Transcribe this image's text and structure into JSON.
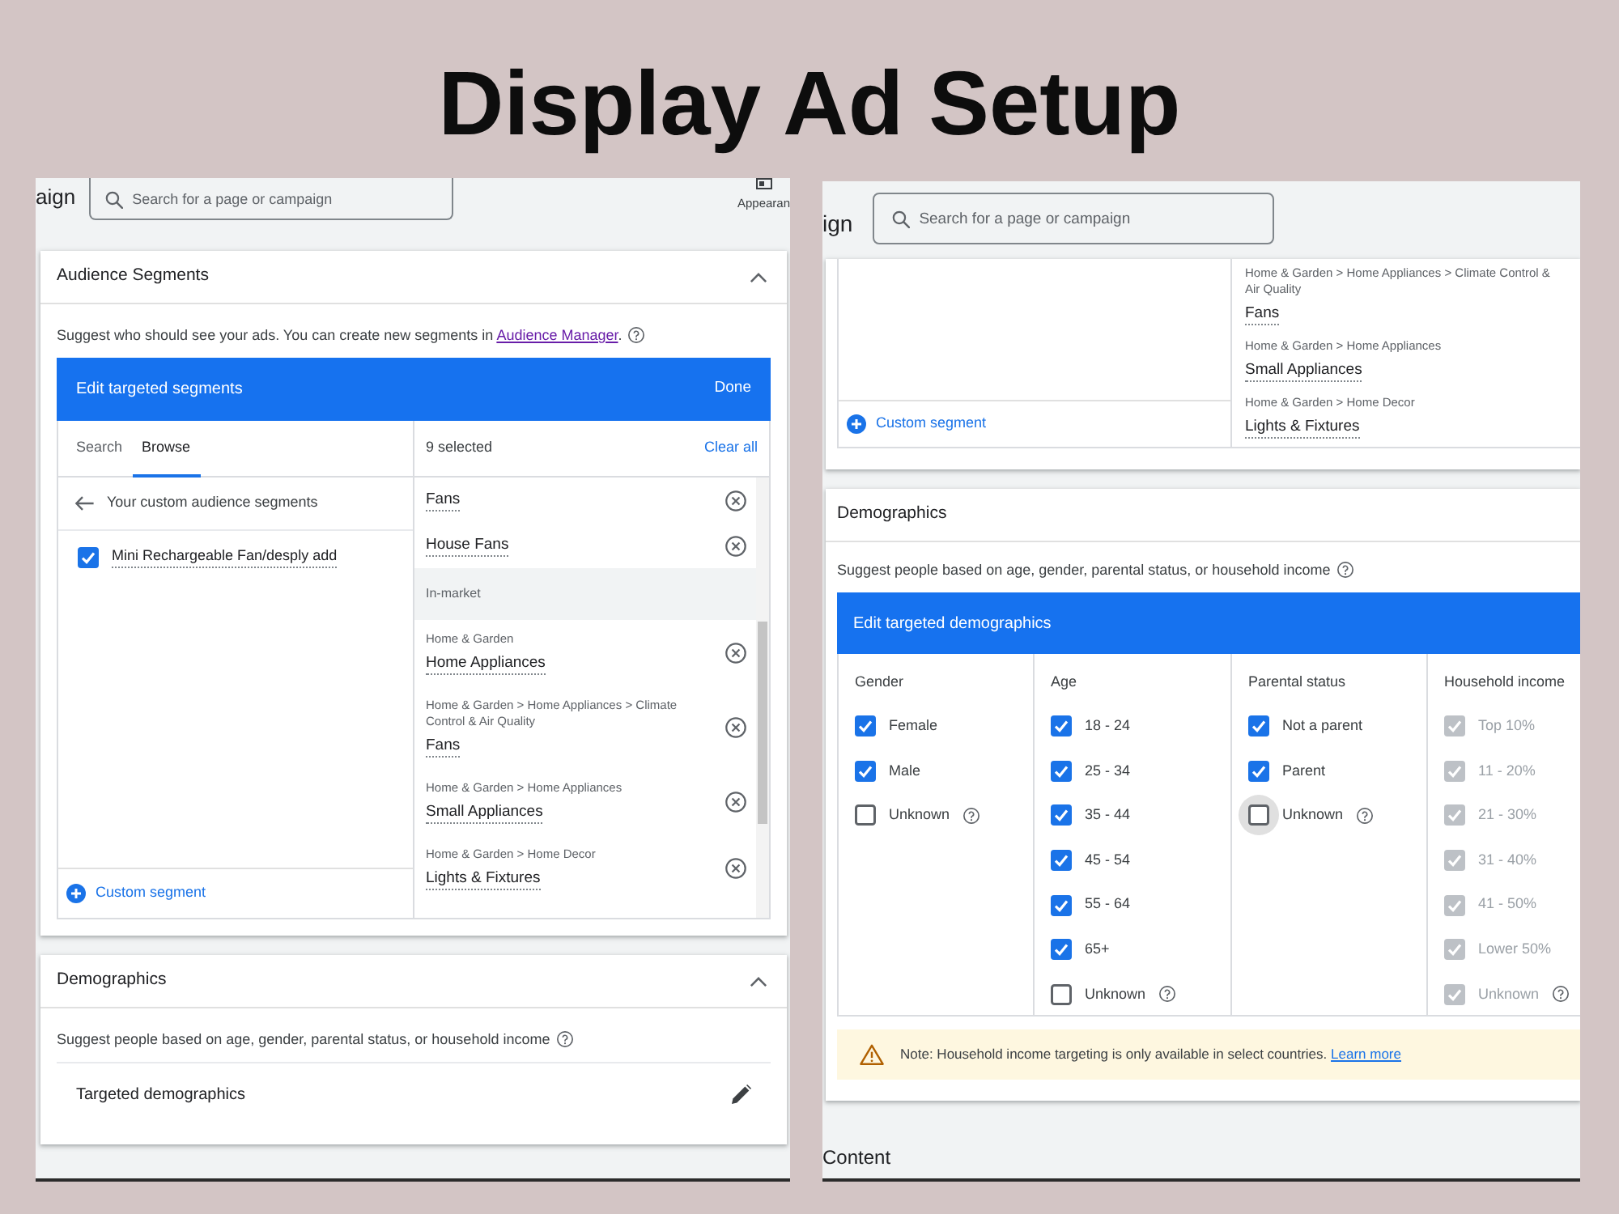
{
  "heading": "Display Ad Setup",
  "left_screenshot": {
    "top_bar": {
      "page_title": "aign",
      "search": {
        "placeholder": "Search for a page or campaign"
      },
      "appearance_label": "Appearan"
    },
    "audience_segments": {
      "title": "Audience Segments",
      "expanded": true,
      "description": "Suggest who should see your ads. You can create new segments in",
      "description_link": "Audience Manager",
      "description_end": ".",
      "editor": {
        "title": "Edit targeted segments",
        "done": "Done",
        "tabs": [
          {
            "label": "Search",
            "selected": false
          },
          {
            "label": "Browse",
            "selected": true
          }
        ],
        "back_label": "Your custom audience segments",
        "segments": [
          {
            "label": "Mini Rechargeable Fan/desply add",
            "checked": true
          }
        ],
        "custom_segment": "Custom segment",
        "selected_count": "9 selected",
        "clear_all": "Clear all",
        "selected_items": [
          {
            "kind": "item",
            "title": "Fans"
          },
          {
            "kind": "item",
            "title": "House Fans"
          },
          {
            "kind": "group",
            "title": "In-market"
          },
          {
            "kind": "item",
            "path": "Home & Garden",
            "title": "Home Appliances"
          },
          {
            "kind": "item",
            "path": "Home & Garden > Home Appliances > Climate Control & Air Quality",
            "title": "Fans"
          },
          {
            "kind": "item",
            "path": "Home & Garden > Home Appliances",
            "title": "Small Appliances"
          },
          {
            "kind": "item",
            "path": "Home & Garden > Home Decor",
            "title": "Lights & Fixtures"
          }
        ]
      }
    },
    "demographics": {
      "title": "Demographics",
      "expanded": true,
      "description": "Suggest people based on age, gender, parental status, or household income",
      "row_label": "Targeted demographics"
    }
  },
  "right_screenshot": {
    "top_bar": {
      "page_title": "ign",
      "search": {
        "placeholder": "Search for a page or campaign"
      }
    },
    "audience_segments": {
      "custom_segment": "Custom segment",
      "selected_items": [
        {
          "kind": "item",
          "path": "Home & Garden > Home Appliances > Climate Control & Air Quality",
          "title": "Fans"
        },
        {
          "kind": "item",
          "path": "Home & Garden > Home Appliances",
          "title": "Small Appliances"
        },
        {
          "kind": "item",
          "path": "Home & Garden > Home Decor",
          "title": "Lights & Fixtures"
        }
      ]
    },
    "demographics": {
      "title": "Demographics",
      "description": "Suggest people based on age, gender, parental status, or household income",
      "editor_title": "Edit targeted demographics",
      "columns": [
        {
          "heading": "Gender",
          "options": [
            {
              "label": "Female",
              "checked": true,
              "disabled": false,
              "has_help": false,
              "focused": false
            },
            {
              "label": "Male",
              "checked": true,
              "disabled": false,
              "has_help": false,
              "focused": false
            },
            {
              "label": "Unknown",
              "checked": false,
              "disabled": false,
              "has_help": true,
              "focused": false
            }
          ]
        },
        {
          "heading": "Age",
          "options": [
            {
              "label": "18 - 24",
              "checked": true,
              "disabled": false,
              "has_help": false,
              "focused": false
            },
            {
              "label": "25 - 34",
              "checked": true,
              "disabled": false,
              "has_help": false,
              "focused": false
            },
            {
              "label": "35 - 44",
              "checked": true,
              "disabled": false,
              "has_help": false,
              "focused": false
            },
            {
              "label": "45 - 54",
              "checked": true,
              "disabled": false,
              "has_help": false,
              "focused": false
            },
            {
              "label": "55 - 64",
              "checked": true,
              "disabled": false,
              "has_help": false,
              "focused": false
            },
            {
              "label": "65+",
              "checked": true,
              "disabled": false,
              "has_help": false,
              "focused": false
            },
            {
              "label": "Unknown",
              "checked": false,
              "disabled": false,
              "has_help": true,
              "focused": false
            }
          ]
        },
        {
          "heading": "Parental status",
          "options": [
            {
              "label": "Not a parent",
              "checked": true,
              "disabled": false,
              "has_help": false,
              "focused": false
            },
            {
              "label": "Parent",
              "checked": true,
              "disabled": false,
              "has_help": false,
              "focused": false
            },
            {
              "label": "Unknown",
              "checked": false,
              "disabled": false,
              "has_help": true,
              "focused": true
            }
          ]
        },
        {
          "heading": "Household income",
          "options": [
            {
              "label": "Top 10%",
              "checked": true,
              "disabled": true,
              "has_help": false,
              "focused": false
            },
            {
              "label": "11 - 20%",
              "checked": true,
              "disabled": true,
              "has_help": false,
              "focused": false
            },
            {
              "label": "21 - 30%",
              "checked": true,
              "disabled": true,
              "has_help": false,
              "focused": false
            },
            {
              "label": "31 - 40%",
              "checked": true,
              "disabled": true,
              "has_help": false,
              "focused": false
            },
            {
              "label": "41 - 50%",
              "checked": true,
              "disabled": true,
              "has_help": false,
              "focused": false
            },
            {
              "label": "Lower 50%",
              "checked": true,
              "disabled": true,
              "has_help": false,
              "focused": false
            },
            {
              "label": "Unknown",
              "checked": true,
              "disabled": true,
              "has_help": true,
              "focused": false
            }
          ]
        }
      ],
      "note": {
        "text": "Note: Household income targeting is only available in select countries.",
        "link": "Learn more"
      }
    },
    "next_section": "Content"
  }
}
